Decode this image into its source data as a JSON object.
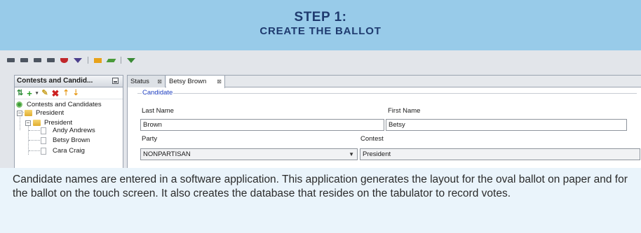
{
  "header": {
    "step": "STEP 1:",
    "title": "CREATE THE BALLOT"
  },
  "toolbar_icons": [
    "ballot-icon",
    "ballot-icon",
    "ballot-icon",
    "ballot-icon",
    "shield-icon",
    "triangle-icon",
    "folder-icon",
    "chart-icon",
    "arrow-down-icon"
  ],
  "left_panel": {
    "title": "Contests and Candid...",
    "tools": [
      "refresh-icon",
      "add-icon",
      "dropdown-caret-icon",
      "edit-icon",
      "delete-icon",
      "move-up-icon",
      "move-down-icon"
    ],
    "tree": {
      "root": "Contests and Candidates",
      "group": "President",
      "contest": "President",
      "candidates": [
        "Andy Andrews",
        "Betsy Brown",
        "Cara Craig"
      ]
    }
  },
  "tabs": [
    {
      "label": "Status",
      "close": "⊠"
    },
    {
      "label": "Betsy Brown",
      "close": "⊠"
    }
  ],
  "form": {
    "group_label": "Candidate",
    "last_name_label": "Last Name",
    "last_name_value": "Brown",
    "first_name_label": "First Name",
    "first_name_value": "Betsy",
    "party_label": "Party",
    "party_value": "NONPARTISAN",
    "contest_label": "Contest",
    "contest_value": "President"
  },
  "caption": "Candidate names are entered in a software application. This application generates the layout for the oval ballot on paper and for the ballot on the touch screen. It also creates the database that resides on the tabulator to record votes.",
  "colors": {
    "header_bg": "#98cbe9",
    "header_text": "#1f3b6f",
    "caption_bg": "#eaf4fb",
    "group_label": "#2040c0"
  }
}
